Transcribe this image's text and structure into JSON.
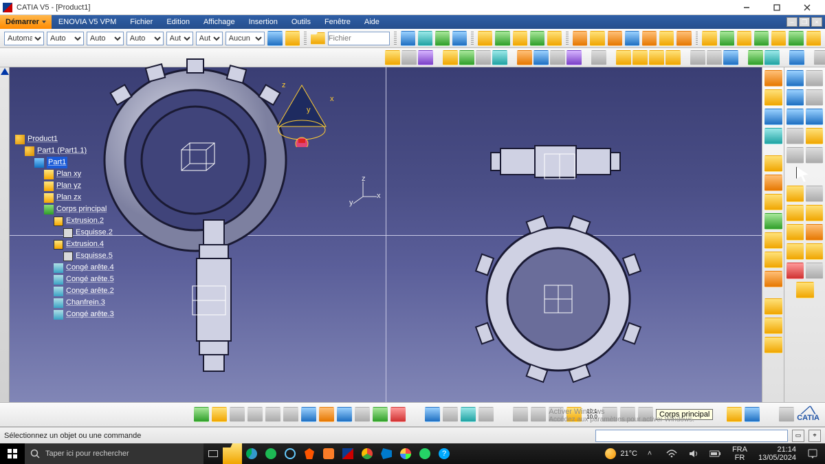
{
  "window": {
    "title": "CATIA V5 - [Product1]"
  },
  "menu": {
    "start": "Démarrer",
    "items": [
      "ENOVIA V5 VPM",
      "Fichier",
      "Edition",
      "Affichage",
      "Insertion",
      "Outils",
      "Fenêtre",
      "Aide"
    ]
  },
  "optrow": {
    "sel1": "Automa",
    "sel2": "Auto",
    "sel3": "Auto",
    "sel4": "Auto",
    "sel5": "Aut",
    "sel6": "Aut",
    "sel7": "Aucun",
    "file_placeholder": "Fichier"
  },
  "tree": {
    "root": "Product1",
    "part_instance": "Part1 (Part1.1)",
    "part": "Part1",
    "planes": [
      "Plan xy",
      "Plan yz",
      "Plan zx"
    ],
    "body": "Corps principal",
    "features": [
      "Extrusion.2",
      "Esquisse.2",
      "Extrusion.4",
      "Esquisse.5",
      "Congé arête.4",
      "Congé arête.5",
      "Congé arête.2",
      "Chanfrein.3",
      "Congé arête.3"
    ]
  },
  "compass": {
    "x": "x",
    "y": "y",
    "z": "z"
  },
  "status": {
    "msg": "Sélectionnez un objet ou une commande"
  },
  "tooltip": {
    "corps": "Corps principal"
  },
  "watermark": {
    "l1": "Activer Windows",
    "l2": "Accédez aux paramètres pour activer Windows."
  },
  "weather": {
    "temp": "21°C"
  },
  "taskbar": {
    "search_placeholder": "Taper ici pour rechercher",
    "lang1": "FRA",
    "lang2": "FR",
    "time": "21:14",
    "date": "13/05/2024"
  },
  "brand": "CATIA",
  "dimlabel": "10.1\n10.0"
}
